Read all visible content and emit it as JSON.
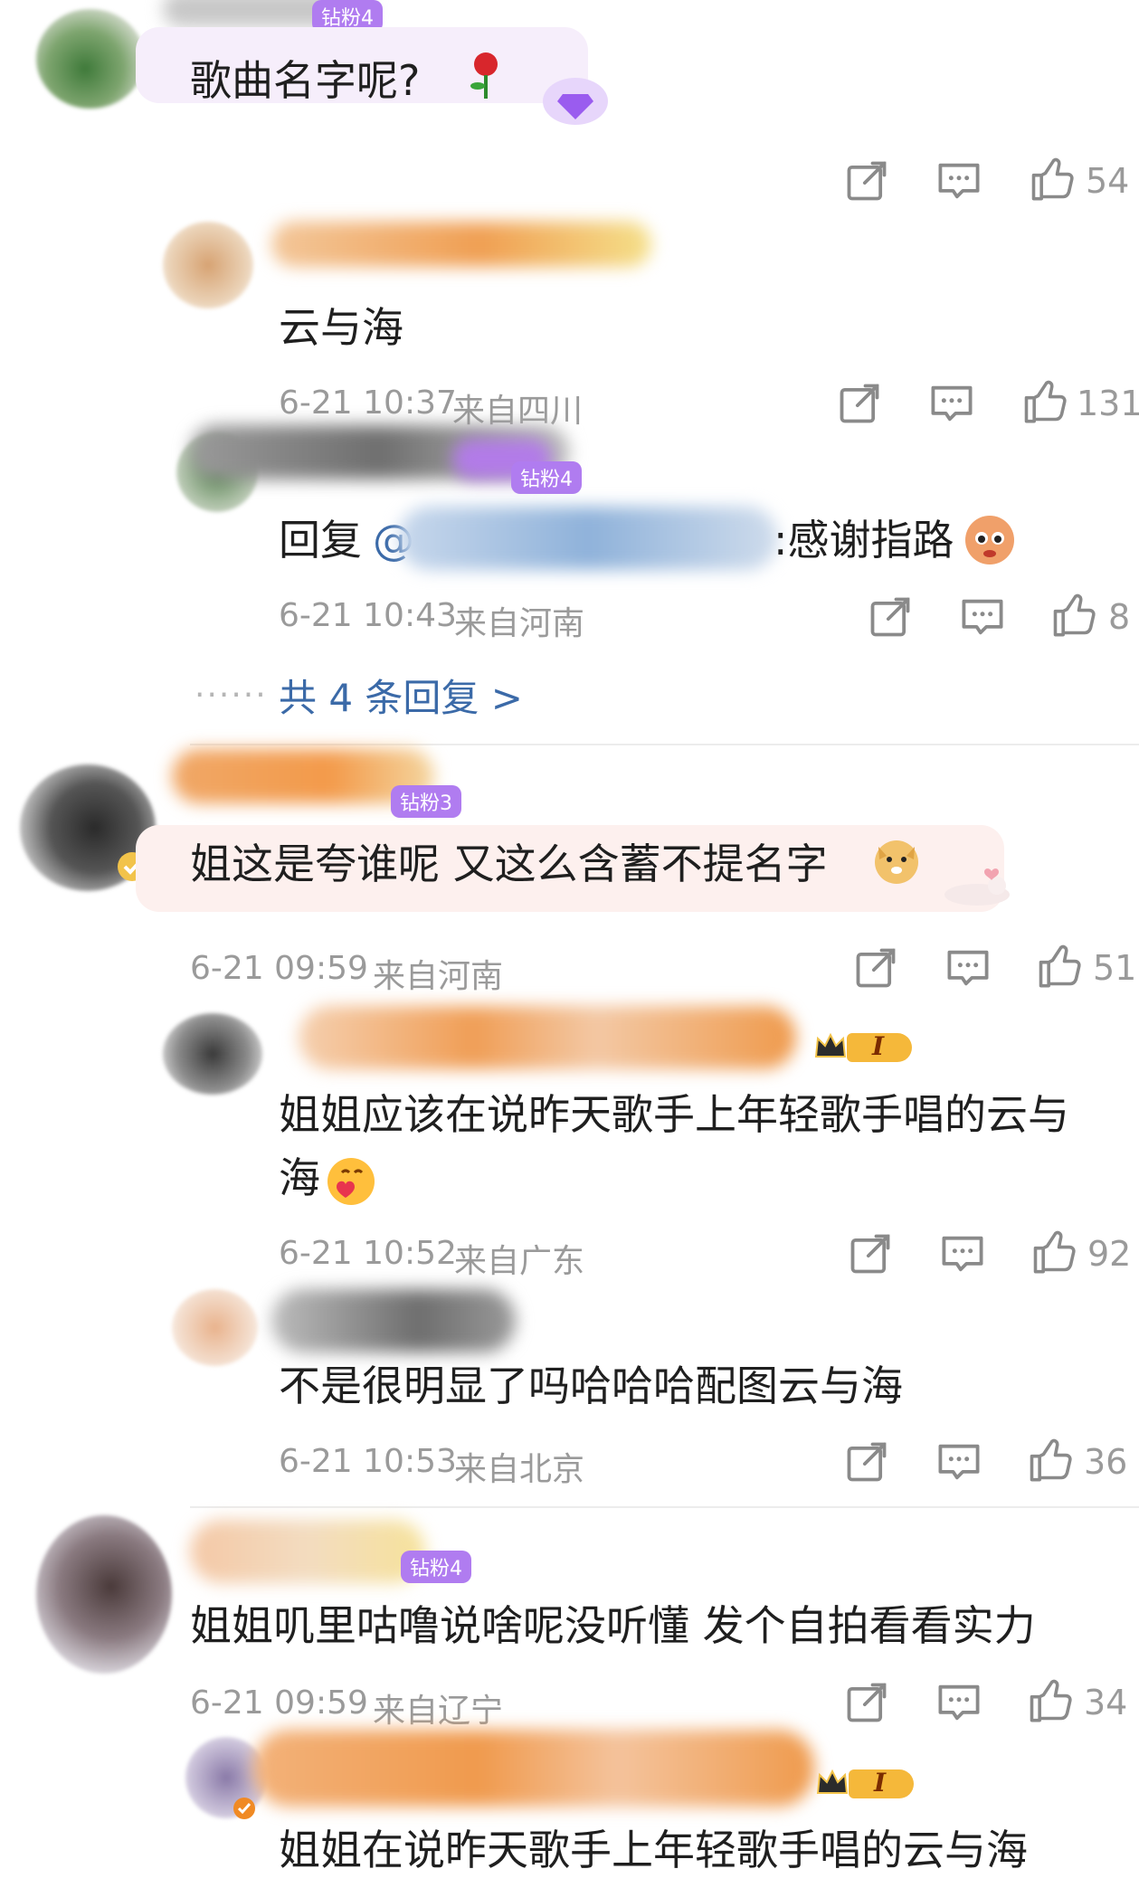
{
  "comments": [
    {
      "badge": "钻粉4",
      "text": "歌曲名字呢?",
      "likes": "54",
      "replies": [
        {
          "text": "云与海",
          "time": "6-21 10:37",
          "location": "来自四川",
          "likes": "131"
        },
        {
          "badge": "钻粉4",
          "reply_prefix": "回复",
          "at": "@",
          "text": ":感谢指路",
          "time": "6-21 10:43",
          "location": "来自河南",
          "likes": "8"
        }
      ],
      "more_replies": "共 4 条回复 >"
    },
    {
      "badge": "钻粉3",
      "text": "姐这是夸谁呢 又这么含蓄不提名字",
      "time": "6-21 09:59",
      "location": "来自河南",
      "likes": "51",
      "replies": [
        {
          "text_line1": "姐姐应该在说昨天歌手上年轻歌手唱的云与",
          "text_line2": "海",
          "time": "6-21 10:52",
          "location": "来自广东",
          "likes": "92"
        },
        {
          "text": "不是很明显了吗哈哈哈配图云与海",
          "time": "6-21 10:53",
          "location": "来自北京",
          "likes": "36"
        }
      ]
    },
    {
      "badge": "钻粉4",
      "text": "姐姐叽里咕噜说啥呢没听懂 发个自拍看看实力",
      "time": "6-21 09:59",
      "location": "来自辽宁",
      "likes": "34",
      "replies": [
        {
          "text": "姐姐在说昨天歌手上年轻歌手唱的云与海"
        }
      ]
    }
  ],
  "level_badge": "I",
  "icons": {
    "share": "share-icon",
    "comment": "comment-icon",
    "like": "thumbs-up-icon",
    "rose": "rose-emoji-icon",
    "diamond": "diamond-fan-icon",
    "doge": "doge-emoji-icon",
    "heart_face": "heart-face-emoji-icon",
    "hungry_face": "hungry-face-emoji-icon",
    "verified": "verified-badge-icon",
    "crown": "crown-icon"
  },
  "colors": {
    "link": "#3b6aa8",
    "meta": "#9a9a9a",
    "badge_purple": "#b07cf0",
    "badge_orange": "#f0a23c",
    "bubble_lilac": "#f6eefb",
    "bubble_pink": "#fdf0ee"
  }
}
